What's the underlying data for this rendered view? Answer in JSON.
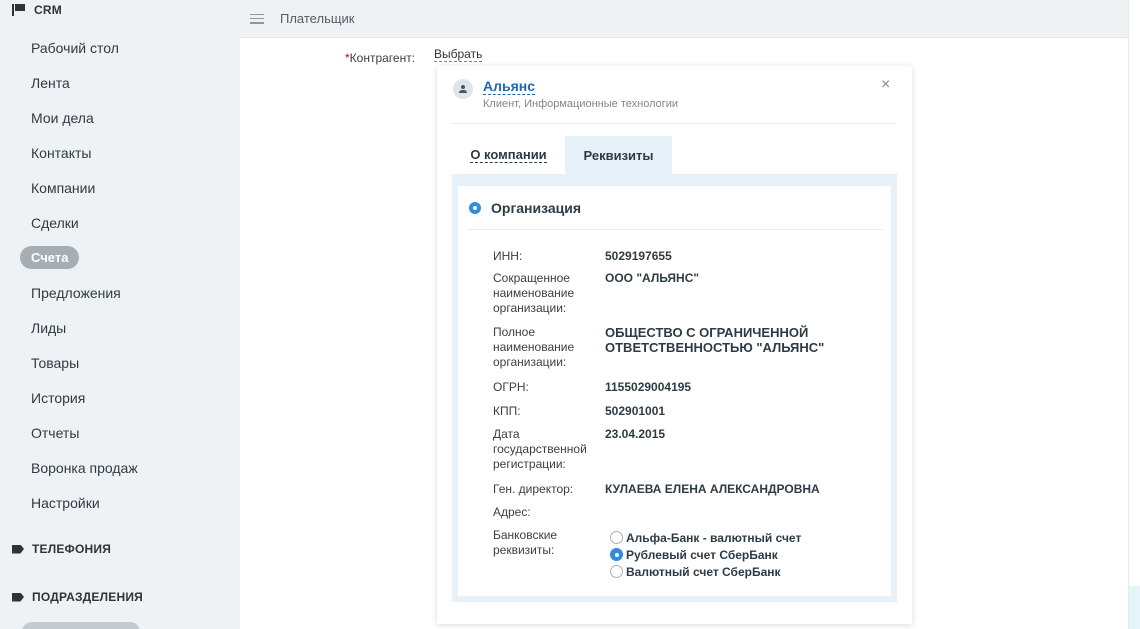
{
  "sidebar": {
    "crm_heading": "CRM",
    "items": [
      {
        "label": "Рабочий стол"
      },
      {
        "label": "Лента"
      },
      {
        "label": "Мои дела"
      },
      {
        "label": "Контакты"
      },
      {
        "label": "Компании"
      },
      {
        "label": "Сделки"
      },
      {
        "label": "Счета",
        "active": true
      },
      {
        "label": "Предложения"
      },
      {
        "label": "Лиды"
      },
      {
        "label": "Товары"
      },
      {
        "label": "История"
      },
      {
        "label": "Отчеты"
      },
      {
        "label": "Воронка продаж"
      },
      {
        "label": "Настройки"
      }
    ],
    "telephony_heading": "ТЕЛЕФОНИЯ",
    "departments_heading": "ПОДРАЗДЕЛЕНИЯ"
  },
  "header": {
    "title": "Плательщик"
  },
  "form": {
    "counterparty_label": "Контрагент:",
    "required_mark": "*",
    "select_link": "Выбрать"
  },
  "card": {
    "company_name": "Альянс",
    "company_sub": "Клиент, Информационные технологии",
    "close": "×",
    "tabs": [
      "О компании",
      "Реквизиты"
    ],
    "active_tab": "Реквизиты",
    "org_title": "Организация",
    "details": [
      {
        "label": "ИНН:",
        "value": "5029197655"
      },
      {
        "label": "Сокращенное наименование организации:",
        "value": "ООО \"АЛЬЯНС\""
      },
      {
        "label": "Полное наименование организации:",
        "value": "ОБЩЕСТВО С ОГРАНИЧЕННОЙ ОТВЕТСТВЕННОСТЬЮ \"АЛЬЯНС\""
      },
      {
        "label": "ОГРН:",
        "value": "1155029004195"
      },
      {
        "label": "КПП:",
        "value": "502901001"
      },
      {
        "label": "Дата государственной регистрации:",
        "value": "23.04.2015"
      },
      {
        "label": "Ген. директор:",
        "value": "КУЛАЕВА ЕЛЕНА АЛЕКСАНДРОВНА"
      },
      {
        "label": "Адрес:",
        "value": ""
      }
    ],
    "bank_label": "Банковские реквизиты:",
    "bank_options": [
      {
        "label": "Альфа-Банк - валютный счет",
        "selected": false
      },
      {
        "label": "Рублевый счет СберБанк",
        "selected": true
      },
      {
        "label": "Валютный счет СберБанк",
        "selected": false
      }
    ]
  },
  "colors": {
    "accent": "#2067b0",
    "radio": "#2f8de0",
    "tab_active_bg": "#e6f2f8"
  }
}
